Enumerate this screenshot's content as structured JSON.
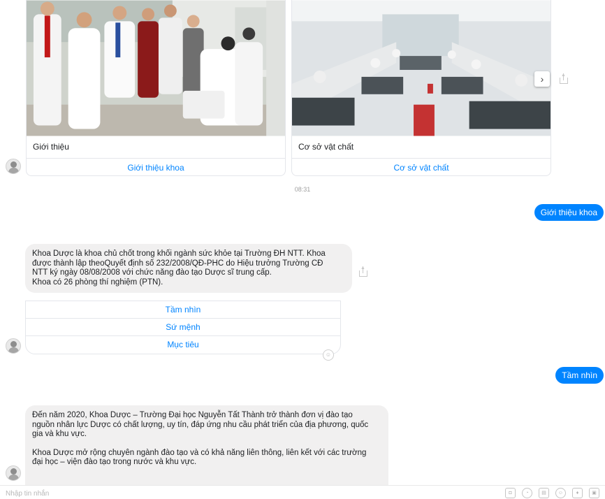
{
  "carousel": {
    "cards": [
      {
        "title": "Giới thiệu",
        "button": "Giới thiệu khoa"
      },
      {
        "title": "Cơ sở vật chất",
        "button": "Cơ sở vật chất"
      }
    ],
    "next_icon": "chevron-right-icon"
  },
  "timestamp": "08:31",
  "messages": {
    "user_1": "Giới thiệu khoa",
    "bot_1": "Khoa Dược là khoa chủ chốt trong khối ngành sức khỏe tại Trường ĐH NTT. Khoa\nđược thành lập theoQuyết định số 232/2008/QĐ-PHC do Hiệu trưởng Trường CĐ\nNTT ký ngày 08/08/2008 với chức năng đào tạo Dược sĩ trung cấp.\nKhoa có 26 phòng thí nghiệm (PTN).",
    "quick_replies": [
      "Tầm nhìn",
      "Sứ mệnh",
      "Mục tiêu"
    ],
    "user_2": "Tầm nhìn",
    "bot_2_p1": "Đến năm 2020, Khoa Dược – Trường Đại học Nguyễn Tất Thành trở thành đơn vị đào tạo\nnguồn nhân lực Dược có chất lượng, uy tín, đáp ứng nhu cầu phát triển của địa phương, quốc\ngia và khu vực.",
    "bot_2_p2": "Khoa Dược mở rộng chuyên ngành đào tạo và có khả năng liên thông, liên kết với các trường\nđại học – viện đào tạo trong nước và khu vực."
  },
  "composer": {
    "placeholder": "Nhập tin nhắn",
    "tools": [
      "camera-icon",
      "sticker-icon",
      "gif-icon",
      "emoji-icon",
      "like-icon",
      "image-icon"
    ]
  },
  "colors": {
    "accent": "#0084ff",
    "bubble_in": "#f1f0f0"
  }
}
